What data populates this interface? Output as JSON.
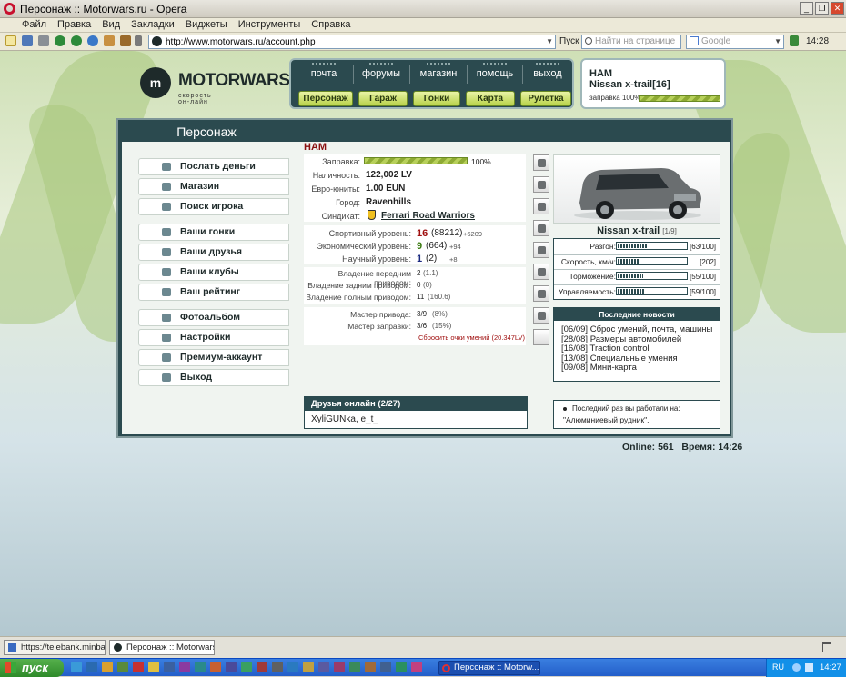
{
  "window": {
    "title": "Персонаж :: Motorwars.ru - Opera"
  },
  "menu": [
    "Файл",
    "Правка",
    "Вид",
    "Закладки",
    "Виджеты",
    "Инструменты",
    "Справка"
  ],
  "address": {
    "url": "http://www.motorwars.ru/account.php",
    "go_label": "Пуск",
    "find_placeholder": "Найти на странице",
    "search_placeholder": "Google",
    "clock": "14:28"
  },
  "logo": {
    "text": "MOTORWARS.RU",
    "subtitle": "скорость он-лайн"
  },
  "nav": {
    "top": [
      "почта",
      "форумы",
      "магазин",
      "помощь",
      "выход"
    ],
    "buttons": [
      "Персонаж",
      "Гараж",
      "Гонки",
      "Карта",
      "Рулетка"
    ]
  },
  "header_car": {
    "player": "НАМ",
    "car": "Nissan x-trail[16]",
    "fuel_label": "заправка 100%",
    "fuel_level": 1.0
  },
  "panel": {
    "title": "Персонаж"
  },
  "sidebar": [
    {
      "label": "Послать деньги",
      "icon": "money-icon"
    },
    {
      "label": "Магазин",
      "icon": "shop-icon"
    },
    {
      "label": "Поиск игрока",
      "icon": "magnifier-icon"
    },
    {
      "label": "Ваши гонки",
      "icon": "steering-wheel-icon"
    },
    {
      "label": "Ваши друзья",
      "icon": "friends-icon"
    },
    {
      "label": "Ваши клубы",
      "icon": "globe-icon"
    },
    {
      "label": "Ваш рейтинг",
      "icon": "rating-chart-icon"
    },
    {
      "label": "Фотоальбом",
      "icon": "camera-icon"
    },
    {
      "label": "Настройки",
      "icon": "sliders-icon"
    },
    {
      "label": "Премиум-аккаунт",
      "icon": "premium-icon"
    },
    {
      "label": "Выход",
      "icon": "exit-icon"
    }
  ],
  "profile": {
    "name": "НАМ",
    "fuel_label": "Заправка:",
    "fuel_pct": "100%",
    "fuel_level": 1.0,
    "cash_label": "Наличность:",
    "cash": "122,002 LV",
    "euro_label": "Евро-юниты:",
    "euro": "1.00 EUN",
    "city_label": "Город:",
    "city": "Ravenhills",
    "syndicate_label": "Синдикат:",
    "syndicate": "Ferrari Road Warriors"
  },
  "levels": [
    {
      "label": "Спортивный уровень:",
      "level": "16",
      "exp": "(88212)",
      "delta": "+6209",
      "color": "#a01010"
    },
    {
      "label": "Экономический уровень:",
      "level": "9",
      "exp": "(664)",
      "delta": "+94",
      "color": "#3a7a10"
    },
    {
      "label": "Научный уровень:",
      "level": "1",
      "exp": "(2)",
      "delta": "+8",
      "color": "#1a2a80"
    }
  ],
  "drive": [
    {
      "label": "Владение передним приводом:",
      "value": "2",
      "extra": "(1.1)"
    },
    {
      "label": "Владение задним приводом:",
      "value": "0",
      "extra": "(0)"
    },
    {
      "label": "Владение полным приводом:",
      "value": "11",
      "extra": "(160.6)"
    }
  ],
  "masters": [
    {
      "label": "Мастер привода:",
      "value": "3/9",
      "extra": "(8%)"
    },
    {
      "label": "Мастер заправки:",
      "value": "3/6",
      "extra": "(15%)"
    }
  ],
  "reset_link": "Сбросить очки умений (20.347LV)",
  "car": {
    "name": "Nissan x-trail",
    "index": "[1/9]"
  },
  "stats": [
    {
      "label": "Разгон:",
      "value": "[63/100]",
      "level": 0.63
    },
    {
      "label": "Скорость, км/ч:",
      "value": "[202]",
      "level": 0.5
    },
    {
      "label": "Торможение:",
      "value": "[55/100]",
      "level": 0.55
    },
    {
      "label": "Управляемость:",
      "value": "[59/100]",
      "level": 0.59
    }
  ],
  "news": {
    "title": "Последние новости",
    "items": [
      {
        "date": "[06/09]",
        "text": "Сброс умений, почта, машины"
      },
      {
        "date": "[28/08]",
        "text": "Размеры автомобилей"
      },
      {
        "date": "[16/08]",
        "text": "Traction control"
      },
      {
        "date": "[13/08]",
        "text": "Специальные умения"
      },
      {
        "date": "[09/08]",
        "text": "Мини-карта"
      }
    ]
  },
  "friends": {
    "title": "Друзья онлайн (2/27)",
    "list": "XyliGUNka, e_t_"
  },
  "lastwork": {
    "text1": "Последний раз вы работали на:",
    "text2": "\"Алюминиевый рудник\"."
  },
  "footer": {
    "online_label": "Online:",
    "online": "561",
    "time_label": "Время:",
    "time": "14:26"
  },
  "tabs": [
    "https://telebank.minban...",
    "Персонаж :: Motorwars.ru"
  ],
  "taskbar": {
    "start": "пуск",
    "window": "Персонаж :: Motorw...",
    "lang": "RU",
    "clock": "14:27"
  }
}
